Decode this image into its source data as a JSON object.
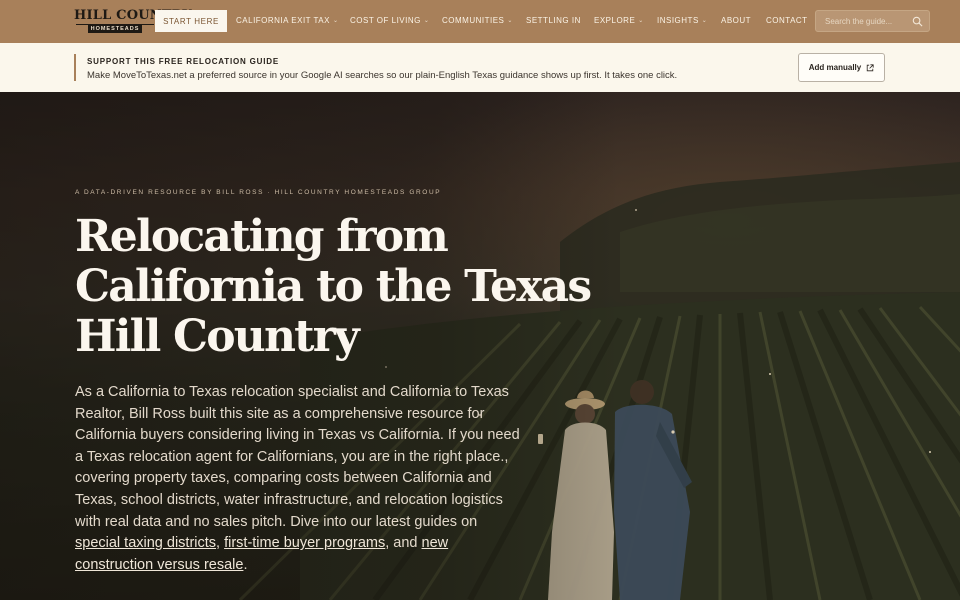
{
  "nav": {
    "logo_text": "HILL COUNTRY",
    "logo_sub": "HOMESTEADS",
    "start_label": "START HERE",
    "items": [
      {
        "label": "CALIFORNIA EXIT TAX",
        "dropdown": true
      },
      {
        "label": "COST OF LIVING",
        "dropdown": true
      },
      {
        "label": "COMMUNITIES",
        "dropdown": true
      },
      {
        "label": "SETTLING IN",
        "dropdown": false
      },
      {
        "label": "EXPLORE",
        "dropdown": true
      },
      {
        "label": "INSIGHTS",
        "dropdown": true
      },
      {
        "label": "ABOUT",
        "dropdown": false
      },
      {
        "label": "CONTACT",
        "dropdown": false
      }
    ],
    "search_placeholder": "Search the guide...",
    "search_icon": "magnifier"
  },
  "banner": {
    "title": "SUPPORT THIS FREE RELOCATION GUIDE",
    "text": "Make MoveToTexas.net a preferred source in your Google AI searches so our plain-English Texas guidance shows up first. It takes one click.",
    "button_label": "Add manually",
    "button_icon": "external-link"
  },
  "hero": {
    "kicker": "A DATA-DRIVEN RESOURCE BY BILL ROSS · HILL COUNTRY HOMESTEADS GROUP",
    "headline_lines": [
      "Relocating from",
      "California to the Texas",
      "Hill Country"
    ],
    "lede_text": "As a California to Texas relocation specialist and California to Texas Realtor, Bill Ross built this site as a comprehensive resource for California buyers considering living in Texas vs California. If you need a Texas relocation agent for Californians, you are in the right place., covering property taxes, comparing costs between California and Texas, school districts, water infrastructure, and relocation logistics with real data and no sales pitch. Dive into our latest guides on ",
    "links": [
      "special taxing districts",
      "first-time buyer programs",
      "new construction versus resale"
    ],
    "sep_1": ", ",
    "sep_2": ", and ",
    "end": "."
  },
  "colors": {
    "nav_bg": "#a8805a",
    "banner_bg": "#fbf7ec",
    "accent": "#a8805a",
    "headline": "#fbf6ee"
  }
}
